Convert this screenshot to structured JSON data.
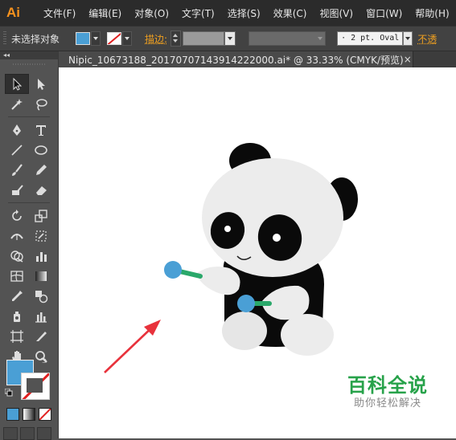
{
  "app": {
    "logo": "Ai",
    "menu": [
      "文件(F)",
      "编辑(E)",
      "对象(O)",
      "文字(T)",
      "选择(S)",
      "效果(C)",
      "视图(V)",
      "窗口(W)",
      "帮助(H)"
    ]
  },
  "controlbar": {
    "selection_label": "未选择对象",
    "stroke_label": "描边:",
    "brush_label": "· 2 pt. Oval",
    "opacity_label": "不透"
  },
  "toolpanel": {
    "header": "◂◂"
  },
  "document": {
    "tab_title": "Nipic_10673188_20170707143914222000.ai* @ 33.33% (CMYK/预览)",
    "close": "×"
  },
  "watermark": {
    "title": "百科全说",
    "subtitle": "助你轻松解决"
  },
  "colors": {
    "fill": "#4a9fd5",
    "stroke": "#e02020",
    "accent_orange": "#f0a020",
    "watermark_green": "#27a24a",
    "arrow_red": "#e8323c"
  }
}
